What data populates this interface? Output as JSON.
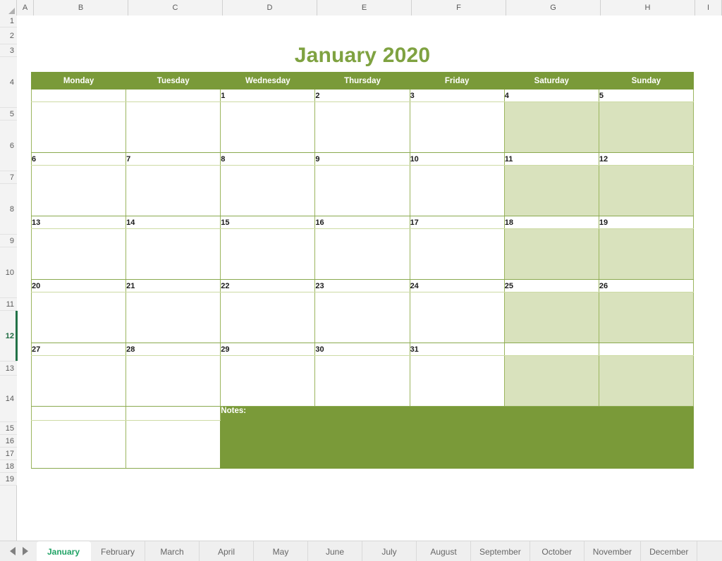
{
  "spreadsheet": {
    "columns": [
      "A",
      "B",
      "C",
      "D",
      "E",
      "F",
      "G",
      "H",
      "I"
    ],
    "rows": [
      "1",
      "2",
      "3",
      "4",
      "5",
      "6",
      "7",
      "8",
      "9",
      "10",
      "11",
      "12",
      "13",
      "14",
      "15",
      "16",
      "17",
      "18",
      "19"
    ],
    "selected_row": "12"
  },
  "calendar": {
    "title": "January 2020",
    "day_headers": [
      "Monday",
      "Tuesday",
      "Wednesday",
      "Thursday",
      "Friday",
      "Saturday",
      "Sunday"
    ],
    "weeks": [
      {
        "days": [
          "",
          "",
          "1",
          "2",
          "3",
          "4",
          "5"
        ]
      },
      {
        "days": [
          "6",
          "7",
          "8",
          "9",
          "10",
          "11",
          "12"
        ]
      },
      {
        "days": [
          "13",
          "14",
          "15",
          "16",
          "17",
          "18",
          "19"
        ]
      },
      {
        "days": [
          "20",
          "21",
          "22",
          "23",
          "24",
          "25",
          "26"
        ]
      },
      {
        "days": [
          "27",
          "28",
          "29",
          "30",
          "31",
          "",
          ""
        ]
      }
    ],
    "notes_label": "Notes:",
    "colors": {
      "header_green": "#7a9a39",
      "title_green": "#7fa241",
      "weekend_shade": "#d9e2bd",
      "grid_line": "#9bb55e"
    }
  },
  "tabbar": {
    "prev_icon": "triangle-left-icon",
    "next_icon": "triangle-right-icon",
    "tabs": [
      {
        "label": "January",
        "active": true
      },
      {
        "label": "February",
        "active": false
      },
      {
        "label": "March",
        "active": false
      },
      {
        "label": "April",
        "active": false
      },
      {
        "label": "May",
        "active": false
      },
      {
        "label": "June",
        "active": false
      },
      {
        "label": "July",
        "active": false
      },
      {
        "label": "August",
        "active": false
      },
      {
        "label": "September",
        "active": false
      },
      {
        "label": "October",
        "active": false
      },
      {
        "label": "November",
        "active": false
      },
      {
        "label": "December",
        "active": false
      }
    ]
  }
}
